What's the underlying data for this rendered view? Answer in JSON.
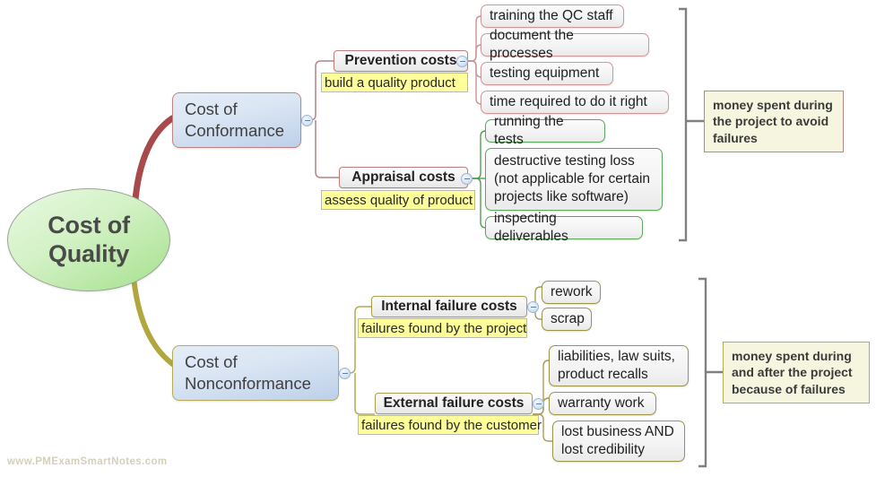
{
  "root": {
    "label": "Cost of\nQuality"
  },
  "watermark": "www.PMExamSmartNotes.com",
  "branches": [
    {
      "id": "conformance",
      "label": "Cost of\nConformance",
      "accent": "#b04a4a",
      "note": "money spent during\nthe project to avoid\nfailures",
      "categories": [
        {
          "title": "Prevention costs",
          "subtitle": "build a quality product",
          "items": [
            "training the QC staff",
            "document the processes",
            "testing equipment",
            "time required to do it right"
          ]
        },
        {
          "title": "Appraisal costs",
          "subtitle": "assess quality of product",
          "items": [
            "running the tests",
            "destructive testing loss\n(not applicable for certain\nprojects like software)",
            "inspecting deliverables"
          ]
        }
      ]
    },
    {
      "id": "nonconformance",
      "label": "Cost of\nNonconformance",
      "accent": "#b0a848",
      "note": "money spent during\nand after the project\nbecause of failures",
      "categories": [
        {
          "title": "Internal failure costs",
          "subtitle": "failures found by the project",
          "items": [
            "rework",
            "scrap"
          ]
        },
        {
          "title": "External failure costs",
          "subtitle": "failures found by the customer",
          "items": [
            "liabilities, law suits,\nproduct recalls",
            "warranty work",
            "lost business AND\nlost credibility"
          ]
        }
      ]
    }
  ],
  "colors": {
    "conformance_line": "#b04a4a",
    "nonconformance_line": "#b0a848",
    "appraisal_line": "#3e9440",
    "bracket": "#808080",
    "highlight": "#ffff99"
  }
}
